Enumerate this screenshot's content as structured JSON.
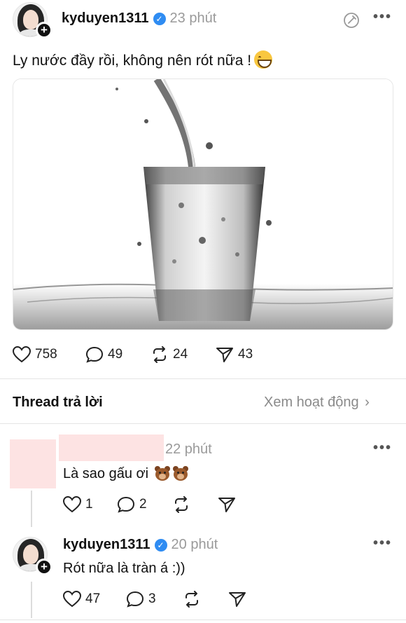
{
  "post": {
    "username": "kyduyen1311",
    "time": "23 phút",
    "text": "Ly nước đầy rồi, không nên rót nữa !",
    "emoji": "grinning-face-emoji",
    "stats": {
      "likes": "758",
      "comments": "49",
      "reposts": "24",
      "shares": "43"
    }
  },
  "replies_header": {
    "title": "Thread trả lời",
    "activity_link": "Xem hoạt động"
  },
  "replies": [
    {
      "username": "",
      "time": "22 phút",
      "text": "Là sao gấu ơi",
      "emoji": "bear-emoji",
      "likes": "1",
      "comments": "2"
    },
    {
      "username": "kyduyen1311",
      "time": "20 phút",
      "text": "Rót nữa là tràn á :))",
      "likes": "47",
      "comments": "3"
    }
  ],
  "colors": {
    "verified": "#2f8cf2",
    "redaction": "#fde3e3",
    "muted": "#9a9a9a"
  }
}
